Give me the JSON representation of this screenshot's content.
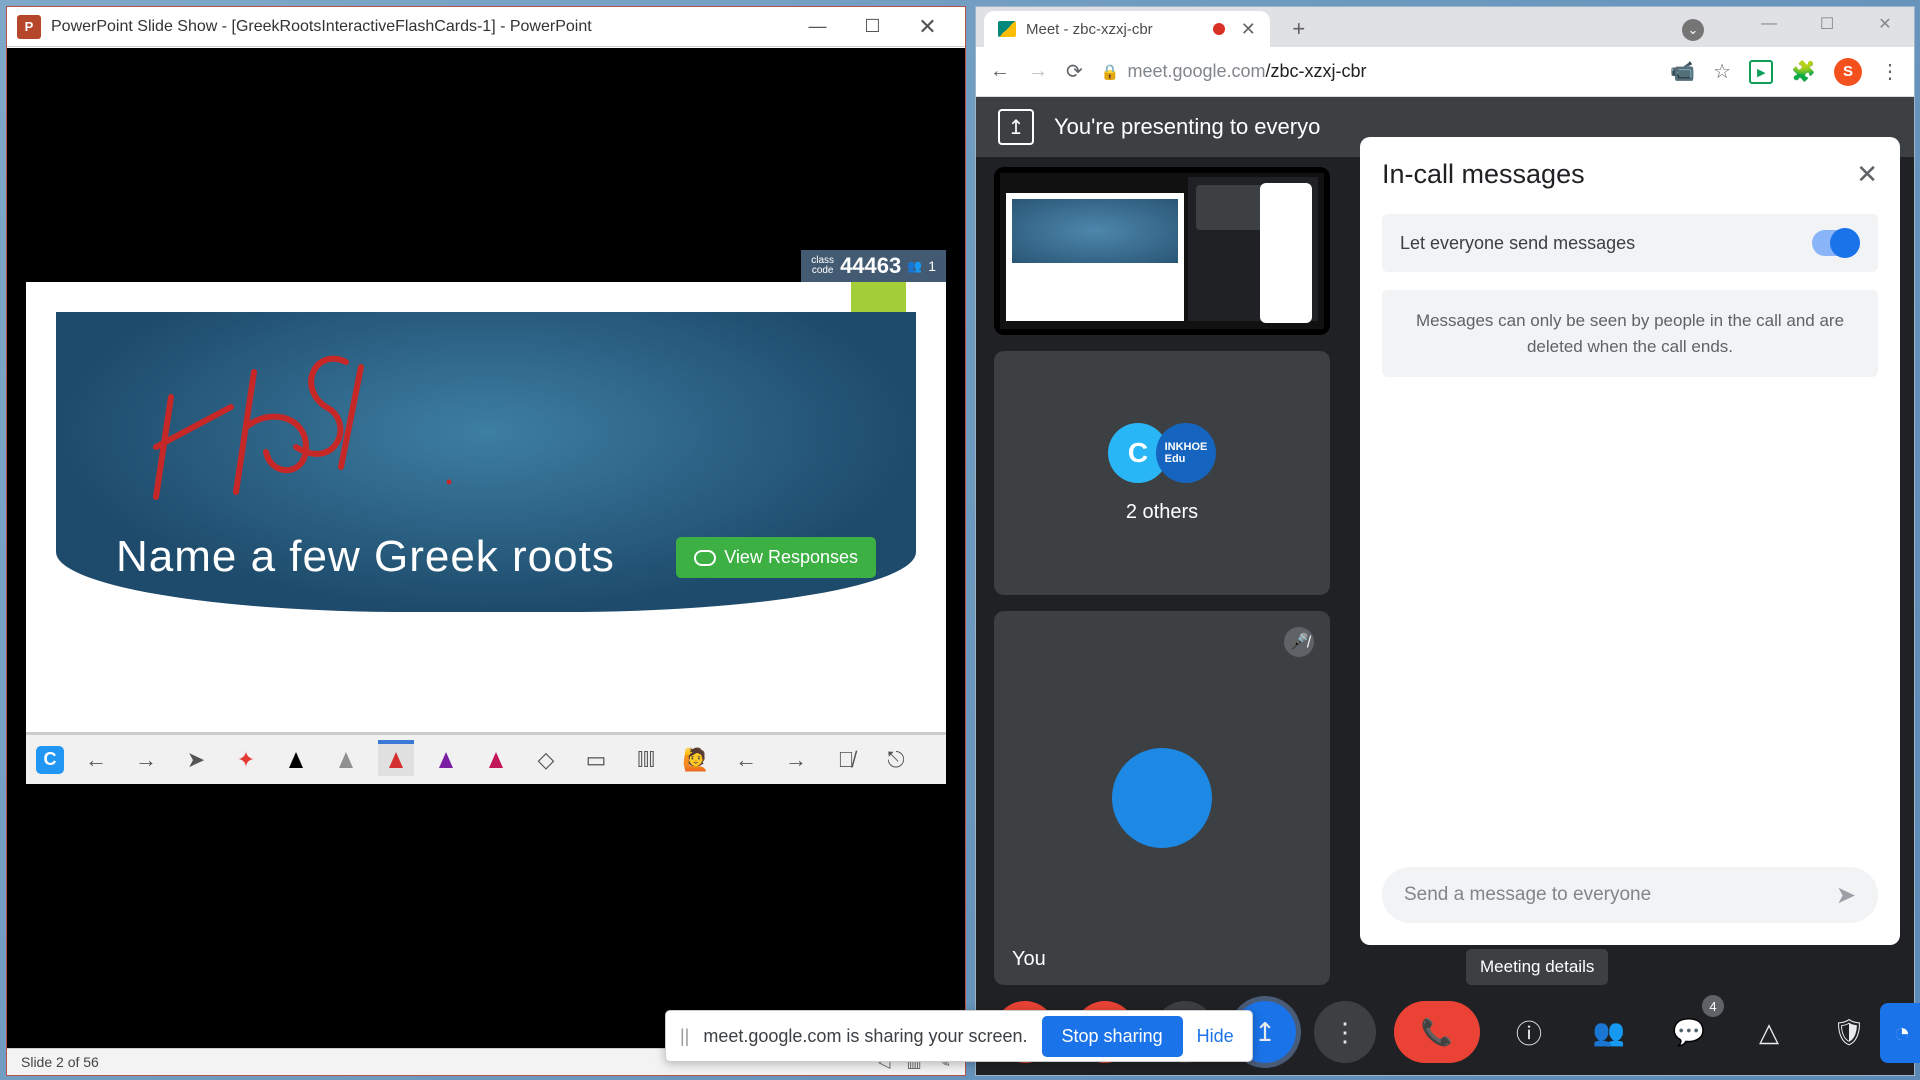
{
  "ppt": {
    "title_text": "PowerPoint Slide Show - [GreekRootsInteractiveFlashCards-1] - PowerPoint",
    "class_code_label": "class\ncode",
    "class_code": "44463",
    "participants": "1",
    "slide_title": "Name a few Greek roots",
    "view_responses": "View Responses",
    "status": "Slide 2 of 56"
  },
  "chrome": {
    "tab_title": "Meet - zbc-xzxj-cbr",
    "url_host": "meet.google.com",
    "url_path": "/zbc-xzxj-cbr",
    "avatar_letter": "S"
  },
  "meet": {
    "presenting_text": "You're presenting to everyo",
    "others_count_label": "2 others",
    "you_label": "You",
    "chat_title": "In-call messages",
    "toggle_label": "Let everyone send messages",
    "info_text": "Messages can only be seen by people in the call and are deleted when the call ends.",
    "input_placeholder": "Send a message to everyone",
    "meeting_details_tooltip": "Meeting details",
    "chat_badge": "4"
  },
  "share_bar": {
    "text": "meet.google.com is sharing your screen.",
    "stop": "Stop sharing",
    "hide": "Hide"
  }
}
